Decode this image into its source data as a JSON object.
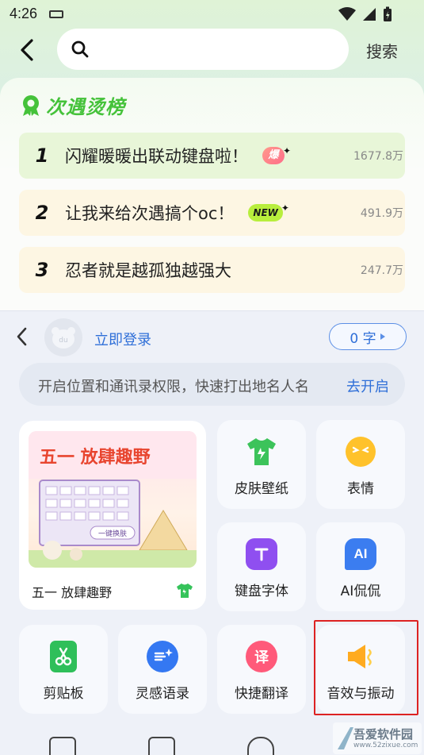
{
  "status_bar": {
    "time": "4:26"
  },
  "header": {
    "search_placeholder": "",
    "search_button": "搜索"
  },
  "hot_list": {
    "title": "次遇烫榜",
    "items": [
      {
        "rank": "1",
        "text": "闪耀暖暖出联动键盘啦！",
        "tag": "爆",
        "count": "1677.8万",
        "bg": "#e8f6d8"
      },
      {
        "rank": "2",
        "text": "让我来给次遇搞个oc！",
        "tag": "NEW",
        "count": "491.9万",
        "bg": "#fdf6e3"
      },
      {
        "rank": "3",
        "text": "忍者就是越孤独越强大",
        "tag": "",
        "count": "247.7万",
        "bg": "#fdf6e3"
      }
    ]
  },
  "keyboard_panel": {
    "login_label": "立即登录",
    "word_count": "0 字",
    "permission": {
      "text": "开启位置和通讯录权限，快速打出地名人名",
      "action": "去开启"
    },
    "banner": {
      "image_title": "五一 放肆趣野",
      "image_sub": "一键换肤",
      "caption": "五一 放肆趣野"
    },
    "tiles": [
      {
        "label": "皮肤壁纸",
        "icon": "tshirt-icon",
        "color": "#3cc35a"
      },
      {
        "label": "表情",
        "icon": "emoji-face-icon",
        "color": "#ffc22b"
      },
      {
        "label": "键盘字体",
        "icon": "font-t-icon",
        "color": "#8f4ff0"
      },
      {
        "label": "AI侃侃",
        "icon": "ai-chat-icon",
        "color": "#3b7df0"
      },
      {
        "label": "剪贴板",
        "icon": "clipboard-scissors-icon",
        "color": "#2fbf5a"
      },
      {
        "label": "灵感语录",
        "icon": "quote-sparkle-icon",
        "color": "#3478f2"
      },
      {
        "label": "快捷翻译",
        "icon": "translate-icon",
        "color": "#ff5a7a"
      },
      {
        "label": "音效与振动",
        "icon": "speaker-vibrate-icon",
        "color": "#ffab1f"
      }
    ]
  },
  "watermark": {
    "name": "吾爱软件园",
    "url": "www.52zixue.com"
  }
}
